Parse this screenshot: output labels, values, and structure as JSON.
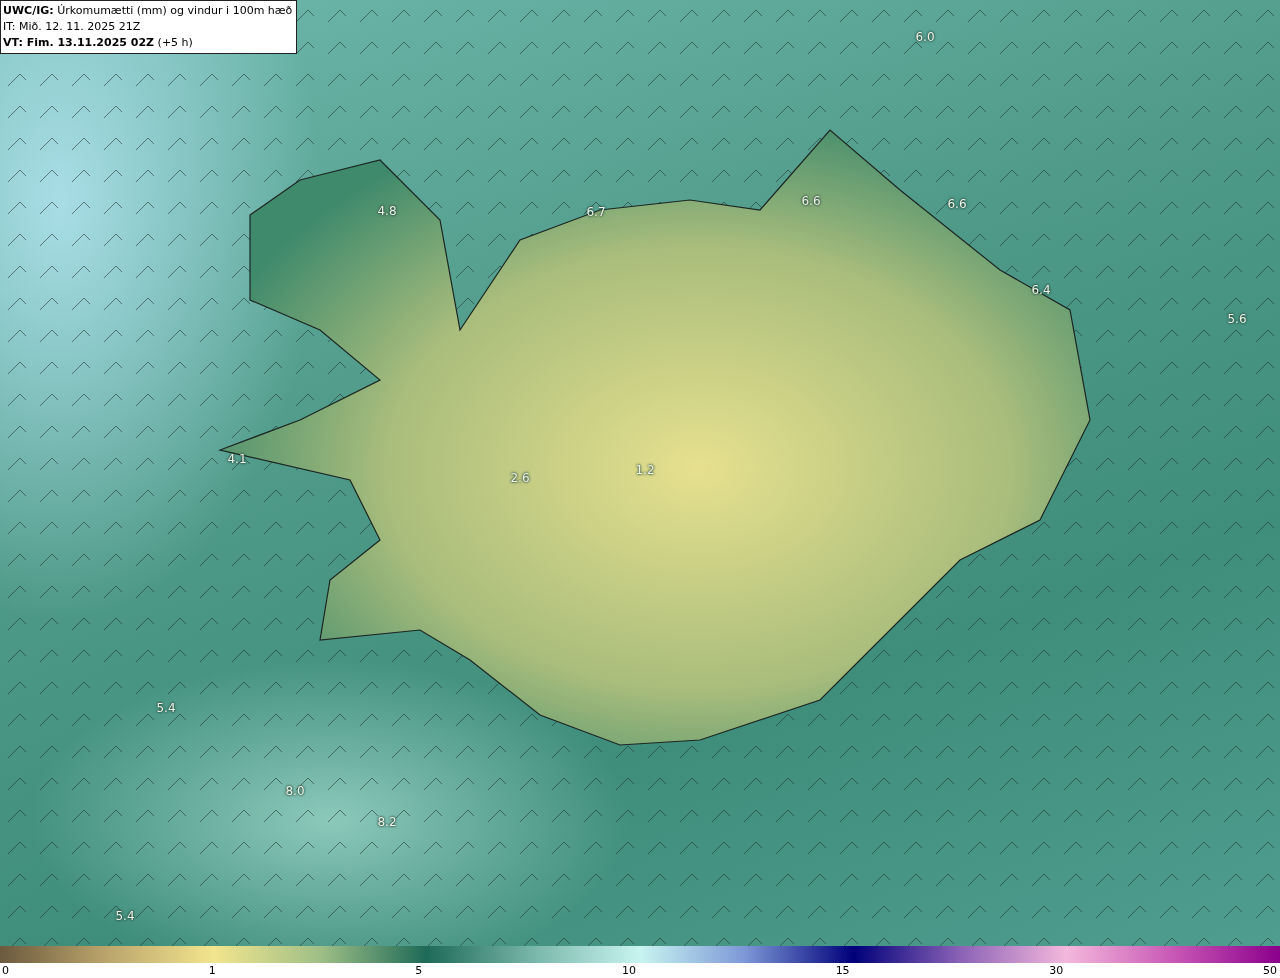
{
  "header": {
    "title": "**UWC/IG:** Úrkomumætti (mm) og vindur i 100m hæð",
    "initial_time": "IT: Mið. 12. 11. 2025 21Z",
    "valid_time": "**VT: Fim. 13.11.2025 02Z** (+5 h)"
  },
  "map": {
    "value_labels": [
      "6.0",
      "4.8",
      "6.7",
      "6.6",
      "6.6",
      "6.4",
      "5.6",
      "4.1",
      "2.6",
      "1.2",
      "5.4",
      "8.0",
      "8.2",
      "5.4"
    ]
  },
  "colorbar": {
    "ticks": [
      "0",
      "1",
      "5",
      "10",
      "15",
      "30",
      "50"
    ]
  }
}
